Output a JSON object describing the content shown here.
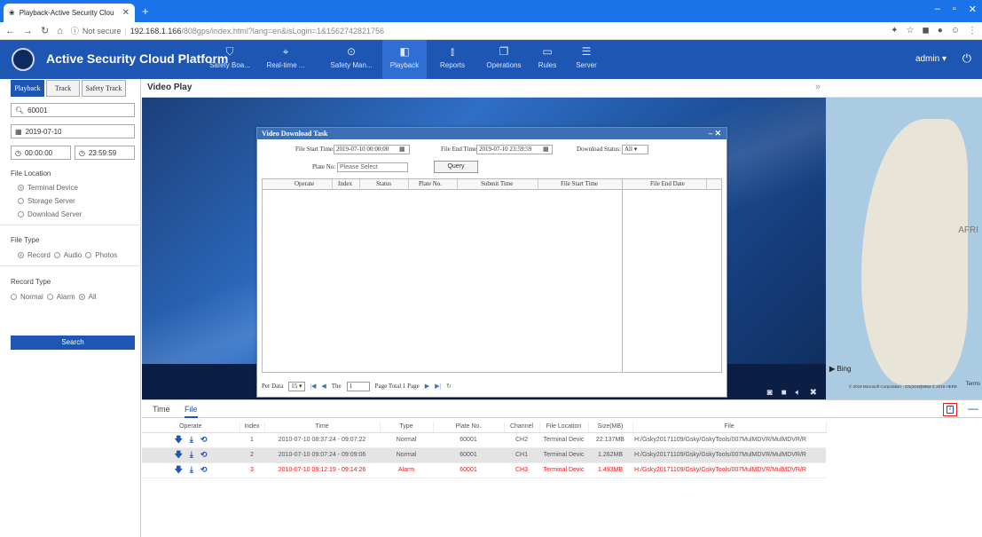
{
  "browser": {
    "tab_title": "Playback-Active Security Clou",
    "address_security": "Not secure",
    "address_host": "192.168.1.166",
    "address_path": "/808gps/index.html?lang=en&isLogin=1&1562742821756"
  },
  "app": {
    "title": "Active Security Cloud Platform",
    "user": "admin",
    "nav": [
      {
        "label": "Safety Boa...",
        "icon": "shield-icon"
      },
      {
        "label": "Real-time ...",
        "icon": "location-pin-icon"
      },
      {
        "label": "Safety Man...",
        "icon": "play-shield-icon"
      },
      {
        "label": "Playback",
        "icon": "playback-icon"
      },
      {
        "label": "Reports",
        "icon": "bar-chart-icon"
      },
      {
        "label": "Operations",
        "icon": "operations-icon"
      },
      {
        "label": "Rules",
        "icon": "rules-icon"
      },
      {
        "label": "Server",
        "icon": "server-icon"
      }
    ]
  },
  "left_panel": {
    "tabs": [
      "Playback",
      "Track",
      "Safety Track"
    ],
    "device_search": "60001",
    "date": "2019-07-10",
    "time_start": "00:00:00",
    "time_end": "23:59:59",
    "file_location_label": "File Location",
    "file_locations": [
      "Terminal Device",
      "Storage Server",
      "Download Server"
    ],
    "file_type_label": "File Type",
    "file_types": [
      "Record",
      "Audio",
      "Photos"
    ],
    "record_type_label": "Record Type",
    "record_types": [
      "Normal",
      "Alarm",
      "All"
    ],
    "search_label": "Search"
  },
  "video_panel": {
    "title": "Video Play",
    "collapse": "»"
  },
  "map": {
    "region_label": "AFRI",
    "bing": "Bing",
    "terms": "Terms",
    "copyright": "© 2019 Microsoft Corporation - GS(2018)5953 © 2019 HERE"
  },
  "dialog": {
    "title": "Video Download Task",
    "file_start_label": "File Start Time:",
    "file_start_value": "2019-07-10 00:00:00",
    "file_end_label": "File End Time:",
    "file_end_value": "2019-07-10 23:59:59",
    "download_status_label": "Download Status:",
    "download_status_value": "All",
    "plate_label": "Plate No:",
    "plate_placeholder": "Please Select",
    "query_label": "Query",
    "columns": [
      "Operate",
      "Index",
      "Status",
      "Plate No.",
      "Submit Time",
      "File Start Time",
      "File End Date"
    ],
    "per_page_label": "Per Data",
    "per_page_value": "15",
    "page_label": "The",
    "page_value": "1",
    "page_total": "Page Total 1 Page"
  },
  "lower": {
    "tabs": [
      "Time",
      "File"
    ],
    "columns": [
      "Operate",
      "Index",
      "Time",
      "Type",
      "Plate No.",
      "Channel",
      "File Location",
      "Size(MB)",
      "File"
    ],
    "rows": [
      {
        "index": "1",
        "time": "2010-07-10 08:37:24 - 09:07:22",
        "type": "Normal",
        "plate": "60001",
        "channel": "CH2",
        "location": "Terminal Devic",
        "size": "22.137MB",
        "file": "H:/Gsky20171109/Gsky/GskyTools/007MulMDVR/MulMDVR/R"
      },
      {
        "index": "2",
        "time": "2010-07-10 09:07:24 - 09:09:06",
        "type": "Normal",
        "plate": "60001",
        "channel": "CH1",
        "location": "Terminal Devic",
        "size": "1.262MB",
        "file": "H:/Gsky20171109/Gsky/GskyTools/007MulMDVR/MulMDVR/R"
      },
      {
        "index": "3",
        "time": "2010-07-10 09:12:19 - 09:14:26",
        "type": "Alarm",
        "plate": "60001",
        "channel": "CH3",
        "location": "Terminal Devic",
        "size": "1.493MB",
        "file": "H:/Gsky20171109/Gsky/GskyTools/007MulMDVR/MulMDVR/R"
      }
    ]
  }
}
